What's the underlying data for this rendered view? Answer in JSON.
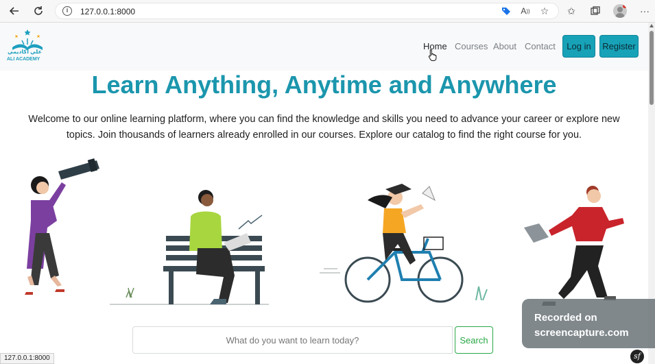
{
  "browser": {
    "url": "127.0.0.1:8000",
    "status_url": "127.0.0.1:8000"
  },
  "navbar": {
    "logo_arabic": "علي أكاديمي",
    "logo_english": "ALI ACADEMY",
    "links": [
      "Home",
      "Courses",
      "About",
      "Contact"
    ],
    "login_label": "Log in",
    "register_label": "Register"
  },
  "hero": {
    "title": "Learn Anything, Anytime and Anywhere",
    "text": "Welcome to our online learning platform, where you can find the knowledge and skills you need to advance your career or explore new topics. Join thousands of learners already enrolled in our courses. Explore our catalog to find the right course for you."
  },
  "search": {
    "placeholder": "What do you want to learn today?",
    "button_label": "Search"
  },
  "watermark": {
    "line1": "Recorded on",
    "line2": "screencapture.com"
  },
  "colors": {
    "brand": "#1b96ad",
    "button": "#17a2b8",
    "search_button": "#28a745"
  }
}
